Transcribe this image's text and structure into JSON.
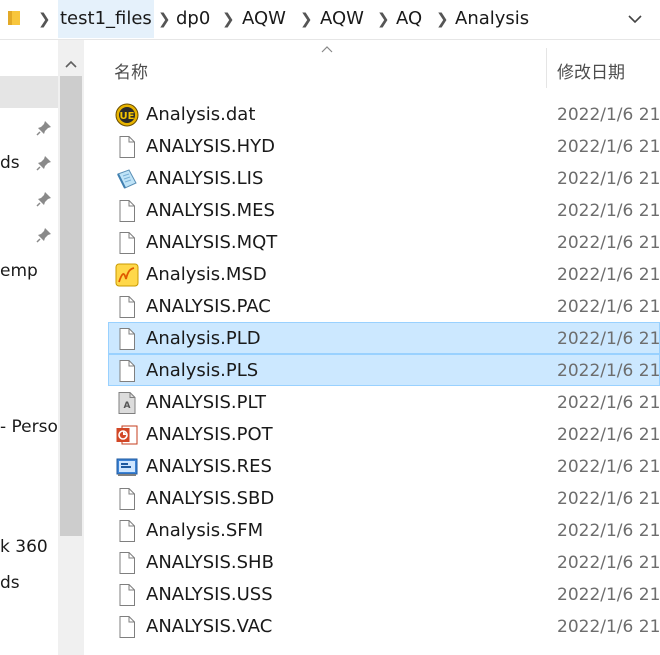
{
  "address": {
    "crumbs": [
      "test1_files",
      "dp0",
      "AQW",
      "AQW",
      "AQ",
      "Analysis"
    ]
  },
  "nav": {
    "labels": [
      "ds",
      "emp",
      "- Perso",
      "k 360",
      "ds"
    ]
  },
  "columns": {
    "name": "名称",
    "date": "修改日期"
  },
  "files": [
    {
      "name": "Analysis.dat",
      "date": "2022/1/6 21",
      "icon": "ultraedit-icon",
      "selected": false
    },
    {
      "name": "ANALYSIS.HYD",
      "date": "2022/1/6 21",
      "icon": "blank-file-icon",
      "selected": false
    },
    {
      "name": "ANALYSIS.LIS",
      "date": "2022/1/6 21",
      "icon": "notepad-icon",
      "selected": false
    },
    {
      "name": "ANALYSIS.MES",
      "date": "2022/1/6 21",
      "icon": "blank-file-icon",
      "selected": false
    },
    {
      "name": "ANALYSIS.MQT",
      "date": "2022/1/6 21",
      "icon": "blank-file-icon",
      "selected": false
    },
    {
      "name": "Analysis.MSD",
      "date": "2022/1/6 21",
      "icon": "msd-app-icon",
      "selected": false
    },
    {
      "name": "ANALYSIS.PAC",
      "date": "2022/1/6 21",
      "icon": "blank-file-icon",
      "selected": false
    },
    {
      "name": "Analysis.PLD",
      "date": "2022/1/6 21",
      "icon": "blank-file-icon",
      "selected": true
    },
    {
      "name": "Analysis.PLS",
      "date": "2022/1/6 21",
      "icon": "blank-file-icon",
      "selected": true
    },
    {
      "name": "ANALYSIS.PLT",
      "date": "2022/1/6 21",
      "icon": "plot-file-icon",
      "selected": false
    },
    {
      "name": "ANALYSIS.POT",
      "date": "2022/1/6 21",
      "icon": "powerpoint-icon",
      "selected": false
    },
    {
      "name": "ANALYSIS.RES",
      "date": "2022/1/6 21",
      "icon": "res-file-icon",
      "selected": false
    },
    {
      "name": "ANALYSIS.SBD",
      "date": "2022/1/6 21",
      "icon": "blank-file-icon",
      "selected": false
    },
    {
      "name": "Analysis.SFM",
      "date": "2022/1/6 21",
      "icon": "blank-file-icon",
      "selected": false
    },
    {
      "name": "ANALYSIS.SHB",
      "date": "2022/1/6 21",
      "icon": "blank-file-icon",
      "selected": false
    },
    {
      "name": "ANALYSIS.USS",
      "date": "2022/1/6 21",
      "icon": "blank-file-icon",
      "selected": false
    },
    {
      "name": "ANALYSIS.VAC",
      "date": "2022/1/6 21",
      "icon": "blank-file-icon",
      "selected": false
    }
  ],
  "colors": {
    "selection_bg": "#cce8ff",
    "selection_border": "#99d1ff",
    "breadcrumb_hover": "#e5f1fb",
    "folder_yellow": "#f8c63d"
  }
}
